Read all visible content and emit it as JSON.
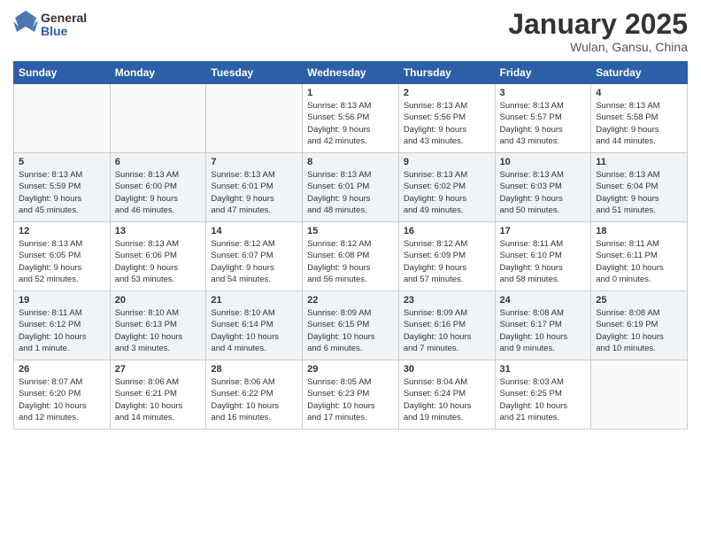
{
  "header": {
    "logo_general": "General",
    "logo_blue": "Blue",
    "title": "January 2025",
    "subtitle": "Wulan, Gansu, China"
  },
  "weekdays": [
    "Sunday",
    "Monday",
    "Tuesday",
    "Wednesday",
    "Thursday",
    "Friday",
    "Saturday"
  ],
  "weeks": [
    [
      {
        "day": "",
        "info": ""
      },
      {
        "day": "",
        "info": ""
      },
      {
        "day": "",
        "info": ""
      },
      {
        "day": "1",
        "info": "Sunrise: 8:13 AM\nSunset: 5:56 PM\nDaylight: 9 hours\nand 42 minutes."
      },
      {
        "day": "2",
        "info": "Sunrise: 8:13 AM\nSunset: 5:56 PM\nDaylight: 9 hours\nand 43 minutes."
      },
      {
        "day": "3",
        "info": "Sunrise: 8:13 AM\nSunset: 5:57 PM\nDaylight: 9 hours\nand 43 minutes."
      },
      {
        "day": "4",
        "info": "Sunrise: 8:13 AM\nSunset: 5:58 PM\nDaylight: 9 hours\nand 44 minutes."
      }
    ],
    [
      {
        "day": "5",
        "info": "Sunrise: 8:13 AM\nSunset: 5:59 PM\nDaylight: 9 hours\nand 45 minutes."
      },
      {
        "day": "6",
        "info": "Sunrise: 8:13 AM\nSunset: 6:00 PM\nDaylight: 9 hours\nand 46 minutes."
      },
      {
        "day": "7",
        "info": "Sunrise: 8:13 AM\nSunset: 6:01 PM\nDaylight: 9 hours\nand 47 minutes."
      },
      {
        "day": "8",
        "info": "Sunrise: 8:13 AM\nSunset: 6:01 PM\nDaylight: 9 hours\nand 48 minutes."
      },
      {
        "day": "9",
        "info": "Sunrise: 8:13 AM\nSunset: 6:02 PM\nDaylight: 9 hours\nand 49 minutes."
      },
      {
        "day": "10",
        "info": "Sunrise: 8:13 AM\nSunset: 6:03 PM\nDaylight: 9 hours\nand 50 minutes."
      },
      {
        "day": "11",
        "info": "Sunrise: 8:13 AM\nSunset: 6:04 PM\nDaylight: 9 hours\nand 51 minutes."
      }
    ],
    [
      {
        "day": "12",
        "info": "Sunrise: 8:13 AM\nSunset: 6:05 PM\nDaylight: 9 hours\nand 52 minutes."
      },
      {
        "day": "13",
        "info": "Sunrise: 8:13 AM\nSunset: 6:06 PM\nDaylight: 9 hours\nand 53 minutes."
      },
      {
        "day": "14",
        "info": "Sunrise: 8:12 AM\nSunset: 6:07 PM\nDaylight: 9 hours\nand 54 minutes."
      },
      {
        "day": "15",
        "info": "Sunrise: 8:12 AM\nSunset: 6:08 PM\nDaylight: 9 hours\nand 56 minutes."
      },
      {
        "day": "16",
        "info": "Sunrise: 8:12 AM\nSunset: 6:09 PM\nDaylight: 9 hours\nand 57 minutes."
      },
      {
        "day": "17",
        "info": "Sunrise: 8:11 AM\nSunset: 6:10 PM\nDaylight: 9 hours\nand 58 minutes."
      },
      {
        "day": "18",
        "info": "Sunrise: 8:11 AM\nSunset: 6:11 PM\nDaylight: 10 hours\nand 0 minutes."
      }
    ],
    [
      {
        "day": "19",
        "info": "Sunrise: 8:11 AM\nSunset: 6:12 PM\nDaylight: 10 hours\nand 1 minute."
      },
      {
        "day": "20",
        "info": "Sunrise: 8:10 AM\nSunset: 6:13 PM\nDaylight: 10 hours\nand 3 minutes."
      },
      {
        "day": "21",
        "info": "Sunrise: 8:10 AM\nSunset: 6:14 PM\nDaylight: 10 hours\nand 4 minutes."
      },
      {
        "day": "22",
        "info": "Sunrise: 8:09 AM\nSunset: 6:15 PM\nDaylight: 10 hours\nand 6 minutes."
      },
      {
        "day": "23",
        "info": "Sunrise: 8:09 AM\nSunset: 6:16 PM\nDaylight: 10 hours\nand 7 minutes."
      },
      {
        "day": "24",
        "info": "Sunrise: 8:08 AM\nSunset: 6:17 PM\nDaylight: 10 hours\nand 9 minutes."
      },
      {
        "day": "25",
        "info": "Sunrise: 8:08 AM\nSunset: 6:19 PM\nDaylight: 10 hours\nand 10 minutes."
      }
    ],
    [
      {
        "day": "26",
        "info": "Sunrise: 8:07 AM\nSunset: 6:20 PM\nDaylight: 10 hours\nand 12 minutes."
      },
      {
        "day": "27",
        "info": "Sunrise: 8:06 AM\nSunset: 6:21 PM\nDaylight: 10 hours\nand 14 minutes."
      },
      {
        "day": "28",
        "info": "Sunrise: 8:06 AM\nSunset: 6:22 PM\nDaylight: 10 hours\nand 16 minutes."
      },
      {
        "day": "29",
        "info": "Sunrise: 8:05 AM\nSunset: 6:23 PM\nDaylight: 10 hours\nand 17 minutes."
      },
      {
        "day": "30",
        "info": "Sunrise: 8:04 AM\nSunset: 6:24 PM\nDaylight: 10 hours\nand 19 minutes."
      },
      {
        "day": "31",
        "info": "Sunrise: 8:03 AM\nSunset: 6:25 PM\nDaylight: 10 hours\nand 21 minutes."
      },
      {
        "day": "",
        "info": ""
      }
    ]
  ]
}
